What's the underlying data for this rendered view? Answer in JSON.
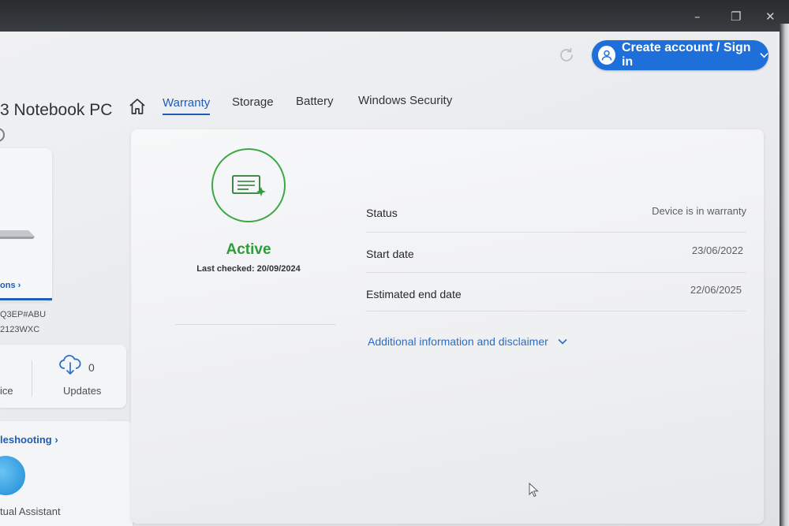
{
  "window": {
    "minimize_glyph": "–",
    "maximize_glyph": "❐",
    "close_glyph": "✕"
  },
  "header": {
    "signin_label": "Create account / Sign in",
    "accent_color": "#1e6fd9"
  },
  "device": {
    "title": "3 Notebook PC",
    "specs_link": "ons ›",
    "product_number": "Q3EP#ABU",
    "serial_number": "2123WXC"
  },
  "tabs": [
    {
      "label": "Warranty",
      "active": true
    },
    {
      "label": "Storage",
      "active": false
    },
    {
      "label": "Battery",
      "active": false
    },
    {
      "label": "Windows Security",
      "active": false
    }
  ],
  "sidebar": {
    "stats": {
      "device_label": "ice",
      "updates_count": "0",
      "updates_label": "Updates"
    },
    "troubleshooting_link": "leshooting ›",
    "assistant_label": "tual Assistant"
  },
  "warranty": {
    "state": "Active",
    "state_color": "#2e9c3a",
    "last_checked": "Last checked: 20/09/2024",
    "rows": [
      {
        "label": "Status",
        "value": "Device is in warranty"
      },
      {
        "label": "Start date",
        "value": "23/06/2022"
      },
      {
        "label": "Estimated end date",
        "value": "22/06/2025"
      }
    ],
    "disclaimer_link": "Additional information and disclaimer"
  }
}
